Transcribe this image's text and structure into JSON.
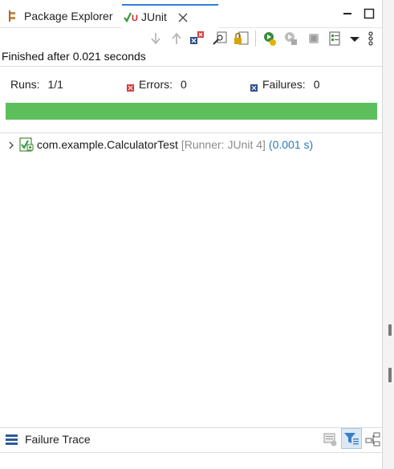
{
  "tabs": [
    {
      "label": "Package Explorer",
      "icon": "package-explorer-icon",
      "active": false
    },
    {
      "label": "JUnit",
      "icon": "junit-icon",
      "active": true
    }
  ],
  "toolbar": {
    "icons": [
      "next-failure-icon",
      "previous-failure-icon",
      "show-failures-only-icon",
      "scroll-lock-icon",
      "rerun-test-icon",
      "rerun-failed-first-icon",
      "stop-icon",
      "test-run-history-icon",
      "view-menu-icon",
      "more-icon"
    ]
  },
  "status": "Finished after 0.021 seconds",
  "counters": {
    "runs_label": "Runs:",
    "runs_value": "1/1",
    "errors_label": "Errors:",
    "errors_value": "0",
    "failures_label": "Failures:",
    "failures_value": "0"
  },
  "progress": {
    "fraction": 1.0,
    "color": "#5cbf5c"
  },
  "tree": [
    {
      "name": "com.example.CalculatorTest",
      "runner": "[Runner: JUnit 4]",
      "time": "(0.001 s)",
      "expanded": false
    }
  ],
  "failure_trace": {
    "title": "Failure Trace",
    "icons": [
      "compare-result-icon",
      "filter-stack-trace-icon",
      "copy-trace-icon"
    ]
  }
}
